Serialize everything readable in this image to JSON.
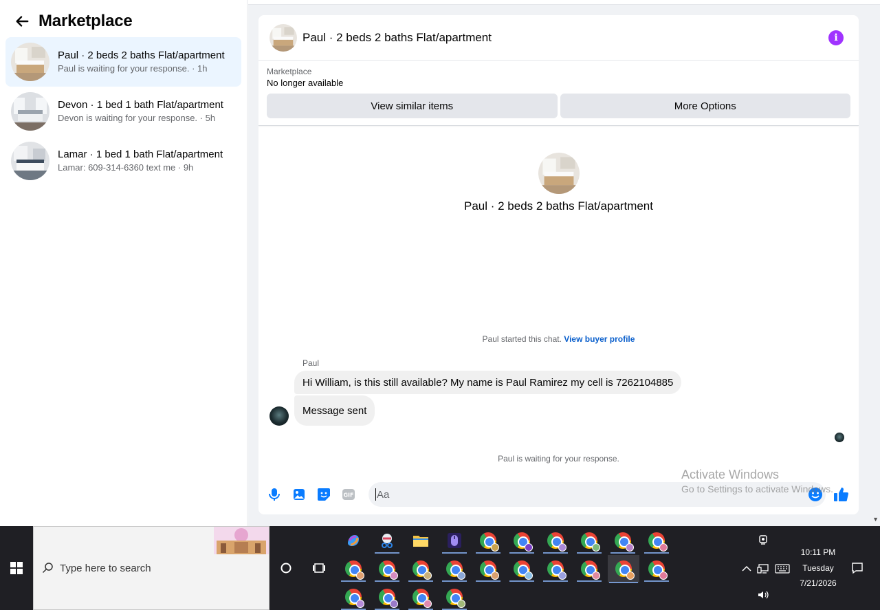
{
  "left_panel": {
    "title": "Marketplace",
    "conversations": [
      {
        "title": "Paul · 2 beds 2 baths Flat/apartment",
        "subtitle": "Paul is waiting for your response. · 1h",
        "active": true
      },
      {
        "title": "Devon · 1 bed 1 bath Flat/apartment",
        "subtitle": "Devon is waiting for your response. · 5h",
        "active": false
      },
      {
        "title": "Lamar · 1 bed 1 bath Flat/apartment",
        "subtitle": "Lamar: 609-314-6360 text me · 9h",
        "active": false
      }
    ]
  },
  "chat": {
    "header_title": "Paul · 2 beds 2 baths Flat/apartment",
    "marketplace_label": "Marketplace",
    "listing_status": "No longer available",
    "btn_similar": "View similar items",
    "btn_more": "More Options",
    "profile_name": "Paul · 2 beds 2 baths Flat/apartment",
    "started_text": "Paul started this chat.",
    "started_link": "View buyer profile",
    "sender_name": "Paul",
    "messages": [
      "Hi William, is this still available? My name is Paul Ramirez my cell is 7262104885",
      "Message sent"
    ],
    "waiting_text": "Paul is waiting for your response.",
    "composer_placeholder": "Aa"
  },
  "watermark": {
    "title": "Activate Windows",
    "subtitle": "Go to Settings to activate Windows."
  },
  "taskbar": {
    "search_placeholder": "Type here to search",
    "time": "10:11 PM",
    "day": "Tuesday",
    "date": "7/21/2026"
  },
  "colors": {
    "accent_blue": "#0a7cff",
    "info_purple": "#a033ff",
    "active_conv_bg": "#ebf5ff",
    "taskbar_bg": "#1f1f24"
  }
}
